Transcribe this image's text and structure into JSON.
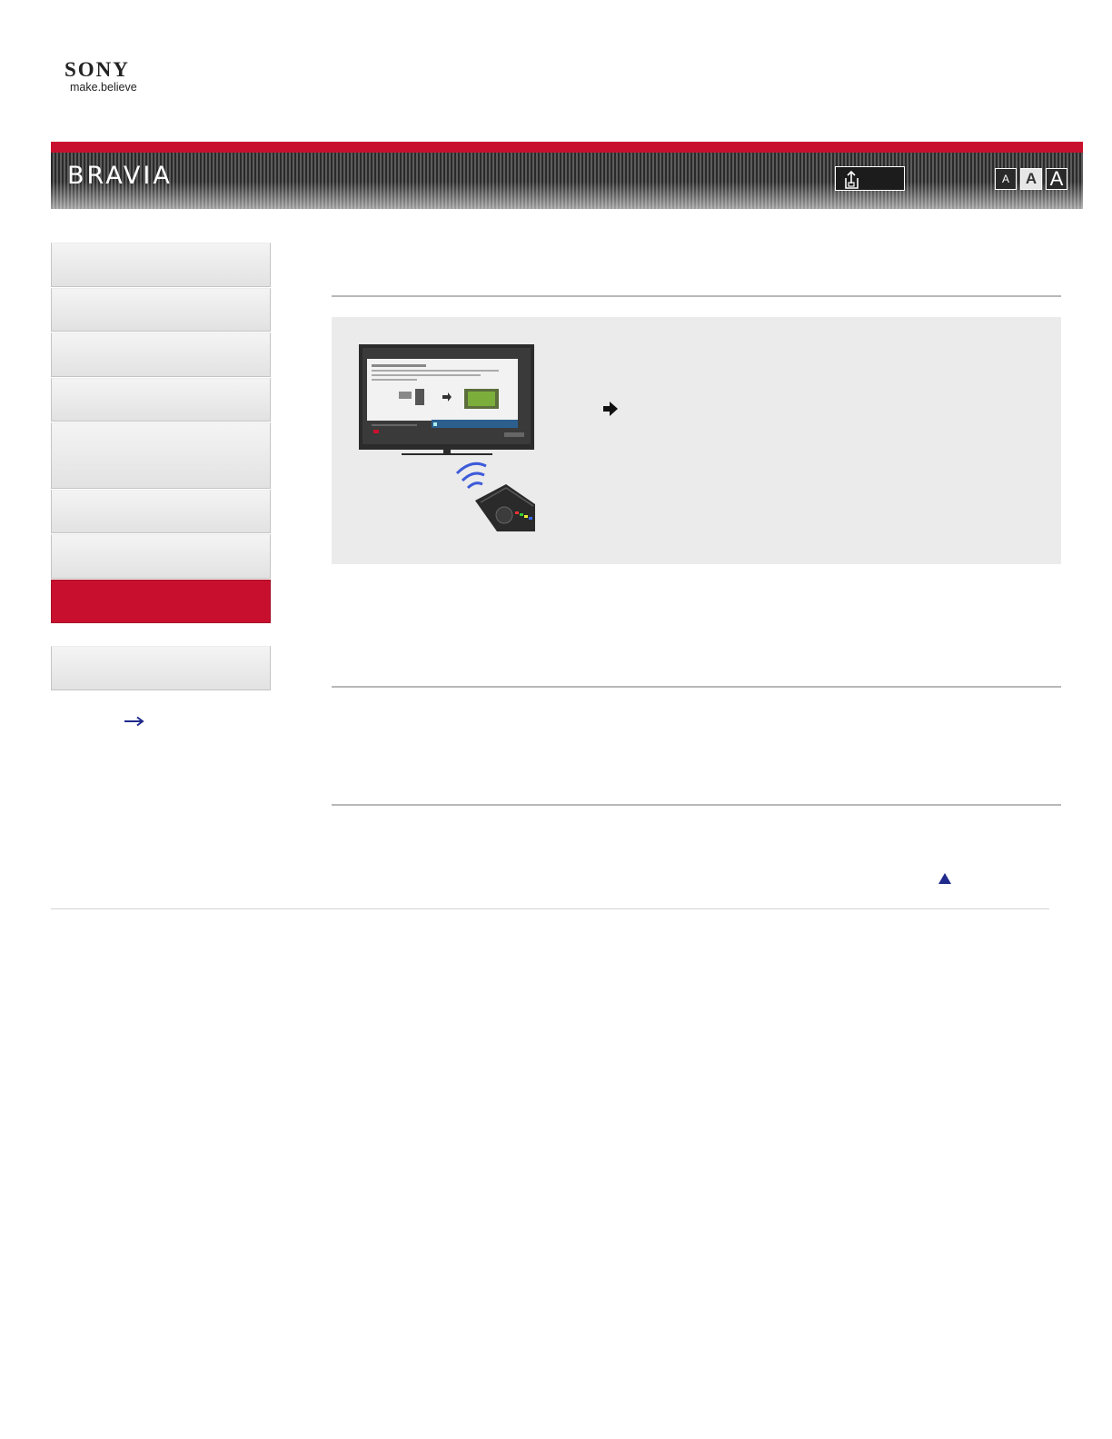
{
  "brand": {
    "company": "SONY",
    "tagline": "make.believe",
    "product": "BRAVIA"
  },
  "colors": {
    "accent_red": "#c8102e",
    "banner_dark": "#2a2a2a",
    "sidebar_bg": "#e8e8e8",
    "feature_bg": "#ebebeb",
    "link_navy": "#1f2a8c"
  },
  "toolbar": {
    "print_icon": "print-icon",
    "font_sizes": [
      {
        "label": "A",
        "size": "small"
      },
      {
        "label": "A",
        "size": "medium"
      },
      {
        "label": "A",
        "size": "large"
      }
    ]
  },
  "sidebar": {
    "items": [
      {
        "label": "",
        "active": false
      },
      {
        "label": "",
        "active": false
      },
      {
        "label": "",
        "active": false
      },
      {
        "label": "",
        "active": false
      },
      {
        "label": "",
        "active": false
      },
      {
        "label": "",
        "active": false
      },
      {
        "label": "",
        "active": false
      },
      {
        "label": "",
        "active": true
      }
    ],
    "secondary_item": {
      "label": ""
    },
    "more_link_icon": "arrow-right-icon"
  },
  "main": {
    "feature_illustration": "tv-remote-illustration",
    "step_icon": "arrow-right-icon",
    "back_to_top_icon": "triangle-up-icon"
  }
}
